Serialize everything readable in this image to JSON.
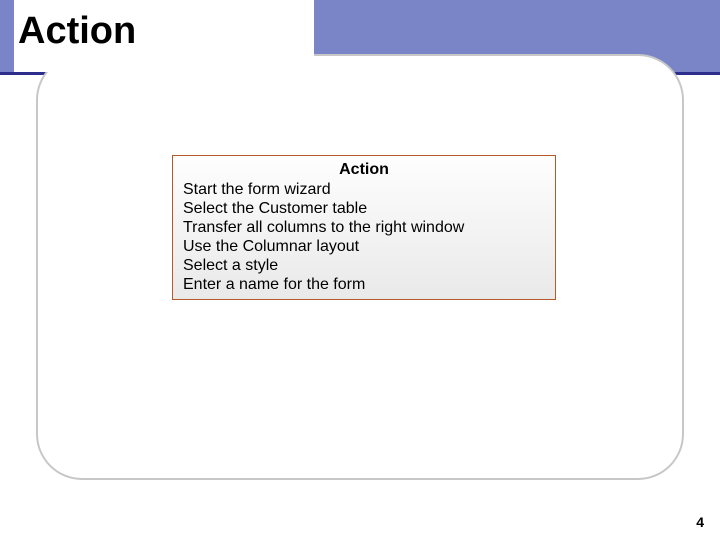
{
  "slide": {
    "title": "Action",
    "page_number": "4"
  },
  "action_box": {
    "heading": "Action",
    "items": {
      "0": "Start the form wizard",
      "1": "Select the Customer table",
      "2": "Transfer all columns to the right window",
      "3": "Use the Columnar layout",
      "4": "Select a style",
      "5": "Enter a name for the form"
    }
  }
}
